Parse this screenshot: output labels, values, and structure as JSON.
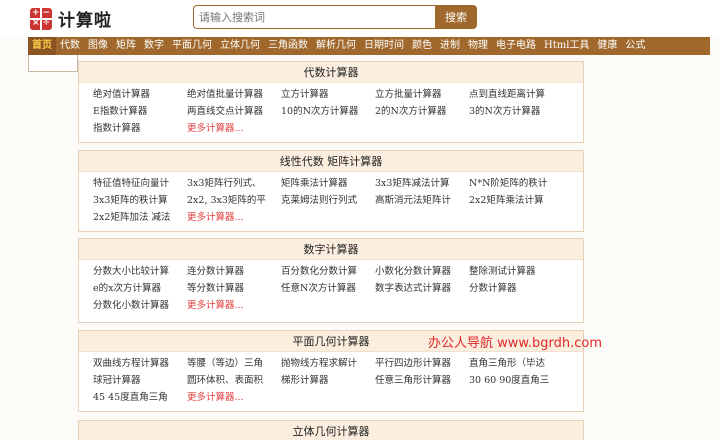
{
  "header": {
    "logo_text": "计算啦",
    "search_placeholder": "请输入搜索词",
    "search_button": "搜索"
  },
  "nav": [
    "首页",
    "代数",
    "图像",
    "矩阵",
    "数字",
    "平面几何",
    "立体几何",
    "三角函数",
    "解析几何",
    "日期时间",
    "颜色",
    "进制",
    "物理",
    "电子电路",
    "Html工具",
    "健康",
    "公式"
  ],
  "panels": [
    {
      "title": "代数计算器",
      "items": [
        "绝对值计算器",
        "绝对值批量计算器",
        "立方计算器",
        "立方批量计算器",
        "点到直线距离计算",
        "E指数计算器",
        "两直线交点计算器",
        "10的N次方计算器",
        "2的N次方计算器",
        "3的N次方计算器",
        "指数计算器",
        "更多计算器..."
      ]
    },
    {
      "title": "线性代数 矩阵计算器",
      "items": [
        "特征值特征向量计",
        "3x3矩阵行列式、",
        "矩阵乘法计算器",
        "3x3矩阵减法计算",
        "N*N阶矩阵的秩计",
        "3x3矩阵的秩计算",
        "2x2, 3x3矩阵的平",
        "克莱姆法则行列式",
        "高斯消元法矩阵计",
        "2x2矩阵乘法计算",
        "2x2矩阵加法 减法",
        "更多计算器..."
      ]
    },
    {
      "title": "数字计算器",
      "items": [
        "分数大小比较计算",
        "连分数计算器",
        "百分数化分数计算",
        "小数化分数计算器",
        "整除测试计算器",
        "e的x次方计算器",
        "等分数计算器",
        "任意N次方计算器",
        "数字表达式计算器",
        "分数计算器",
        "分数化小数计算器",
        "更多计算器..."
      ]
    },
    {
      "title": "平面几何计算器",
      "items": [
        "双曲线方程计算器",
        "等腰（等边）三角",
        "抛物线方程求解计",
        "平行四边形计算器",
        "直角三角形（毕达",
        "球冠计算器",
        "圆环体积、表面积",
        "梯形计算器",
        "任意三角形计算器",
        "30 60 90度直角三",
        "45 45度直角三角",
        "更多计算器..."
      ]
    },
    {
      "title": "立体几何计算器",
      "items": []
    }
  ],
  "watermark": "办公人导航 www.bgrdh.com"
}
